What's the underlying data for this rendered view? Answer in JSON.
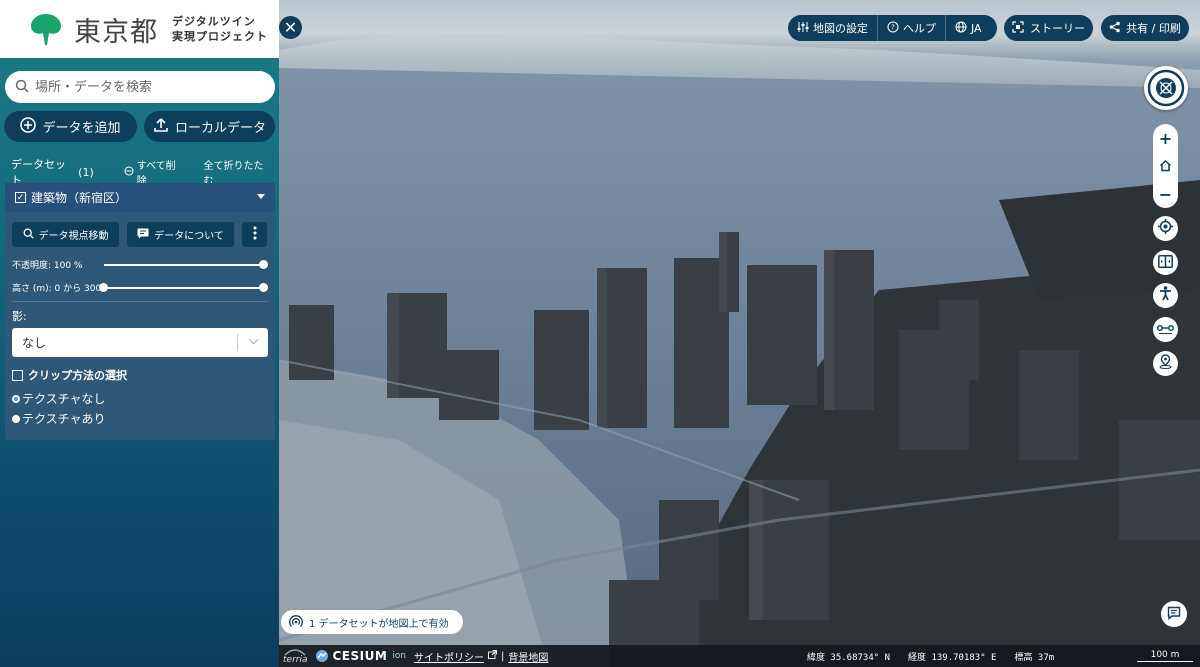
{
  "brand": {
    "name": "東京都",
    "sub_line1": "デジタルツイン",
    "sub_line2": "実現プロジェクト",
    "logo_color": "#1aa36b"
  },
  "search": {
    "placeholder": "場所・データを検索"
  },
  "actions": {
    "add_data": "データを追加",
    "local_data": "ローカルデータ"
  },
  "datasets": {
    "label": "データセット",
    "count": "(1)",
    "remove_all": "すべて削除",
    "collapse_all": "全て折りたたむ"
  },
  "layer": {
    "title": "建築物（新宿区）",
    "checked": true,
    "zoom_to": "データ視点移動",
    "about": "データについて",
    "opacity_label": "不透明度: 100 %",
    "opacity_value": 1.0,
    "height_label": "高さ (m): 0 から 300",
    "height_range": [
      0,
      300
    ],
    "shadow_label": "影:",
    "shadow_value": "なし",
    "clip_label": "クリップ方法の選択",
    "texture_options": [
      {
        "label": "テクスチャなし",
        "selected": true
      },
      {
        "label": "テクスチャあり",
        "selected": false
      }
    ]
  },
  "toolbar": {
    "map_settings": "地図の設定",
    "help": "ヘルプ",
    "language": "JA",
    "story": "ストーリー",
    "share": "共有 / 印刷"
  },
  "map": {
    "active_datasets": "1 データセットが地図上で有効",
    "terria": "terria",
    "cesium": "CESIUM",
    "ion": "ion",
    "privacy": "サイトポリシー",
    "basemap": "背景地図",
    "latitude": "緯度  35.68734° N",
    "longitude": "経度  139.70183° E",
    "elevation": "標高  37m",
    "scale": "100 m"
  },
  "colors": {
    "accent": "#0f3d5c",
    "sidebar_top": "#1b7d86",
    "sidebar_bottom": "#0b3c5e",
    "panel": "#2f5878",
    "radio_on": "#4aa3df"
  }
}
